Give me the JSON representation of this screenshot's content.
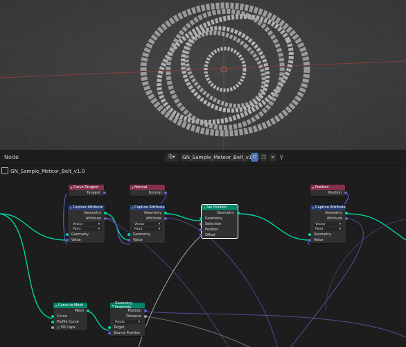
{
  "editor": {
    "type_label": "Node",
    "datablock_name": "GN_Sample_Meteor_Belt_v1.0",
    "breadcrumb": "GN_Sample_Meteor_Belt_v1.0"
  },
  "nodes": {
    "curve_tangent": {
      "title": "Curve Tangent",
      "out": "Tangent"
    },
    "normal": {
      "title": "Normal",
      "out": "Normal"
    },
    "position_input": {
      "title": "Position",
      "out": "Position"
    },
    "capture1": {
      "title": "Capture Attribute",
      "out_geo": "Geometry",
      "out_attr": "Attribute",
      "type": "Vector",
      "domain": "Point",
      "in_geo": "Geometry",
      "in_val": "Value"
    },
    "capture2": {
      "title": "Capture Attribute",
      "out_geo": "Geometry",
      "out_attr": "Attribute",
      "type": "Vector",
      "domain": "Point",
      "in_geo": "Geometry",
      "in_val": "Value"
    },
    "capture3": {
      "title": "Capture Attribute",
      "out_geo": "Geometry",
      "out_attr": "Attribute",
      "type": "Vector",
      "domain": "Point",
      "in_geo": "Geometry",
      "in_val": "Value"
    },
    "set_position": {
      "title": "Set Position",
      "out_geo": "Geometry",
      "in_geo": "Geometry",
      "in_sel": "Selection",
      "in_pos": "Position",
      "in_off": "Offset"
    },
    "curve_to_mesh": {
      "title": "Curve to Mesh",
      "out": "Mesh",
      "in_curve": "Curve",
      "in_profile": "Profile Curve",
      "in_fill": "Fill Caps"
    },
    "proximity": {
      "title": "Geometry Proximity",
      "out_pos": "Position",
      "out_dist": "Distance",
      "mode": "Points",
      "in_target": "Target",
      "in_src": "Source Position"
    }
  },
  "colors": {
    "input_header": "#83314a",
    "attribute_header": "#273a6e",
    "geometry_header": "#00846a",
    "geometry_socket": "#00d6a3",
    "vector_socket": "#6363c7",
    "viewport_bg": "#3d3d3d"
  }
}
